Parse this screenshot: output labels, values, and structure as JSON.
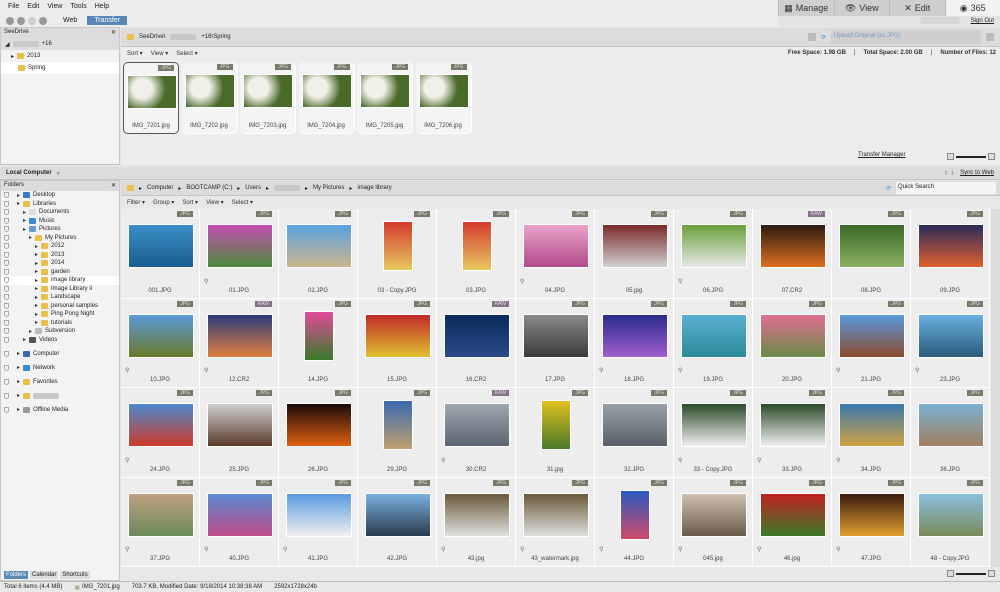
{
  "menu": [
    "File",
    "Edit",
    "View",
    "Tools",
    "Help"
  ],
  "toolbar": {
    "web": "Web",
    "transfer": "Transfer"
  },
  "mode_tabs": [
    {
      "label": "Manage",
      "icon": "grid-icon"
    },
    {
      "label": "View",
      "icon": "eye-icon"
    },
    {
      "label": "Edit",
      "icon": "tools-icon"
    },
    {
      "label": "365",
      "icon": "365-icon"
    }
  ],
  "sign_out": "Sign Out",
  "seedrive": {
    "title": "SeeDrive",
    "account_suffix": "+16",
    "items": [
      "2013",
      "Spring"
    ],
    "path_prefix": "SeeDrive\\",
    "path_suffix": "+16\\Spring",
    "menu": [
      "Sort ▾",
      "View ▾",
      "Select ▾"
    ],
    "upload": "Upload Original (as JPG)",
    "free_space": "Free Space: 1.98 GB",
    "total_space": "Total Space: 2.00 GB",
    "num_files": "Number of Files: 12",
    "transfer_manager": "Transfer Manager",
    "thumbs": [
      "IMG_7201.jpg",
      "IMG_7202.jpg",
      "IMG_7203.jpg",
      "IMG_7204.jpg",
      "IMG_7205.jpg",
      "IMG_7206.jpg"
    ]
  },
  "local": {
    "title": "Local Computer",
    "sync": "Sync to Web",
    "folders_title": "Folders",
    "tree": [
      [
        "Desktop",
        1
      ],
      [
        "Libraries",
        1
      ],
      [
        "Documents",
        2
      ],
      [
        "Music",
        2
      ],
      [
        "Pictures",
        2
      ],
      [
        "My Pictures",
        3
      ],
      [
        "2012",
        4
      ],
      [
        "2013",
        4
      ],
      [
        "2014",
        4
      ],
      [
        "garden",
        4
      ],
      [
        "image library",
        4
      ],
      [
        "Image Library ii",
        4
      ],
      [
        "Landscape",
        4
      ],
      [
        "personal samples",
        4
      ],
      [
        "Ping Pong Night",
        4
      ],
      [
        "tutorials",
        4
      ],
      [
        "Subversion",
        3
      ],
      [
        "Videos",
        2
      ],
      [
        "Computer",
        1
      ],
      [
        "Network",
        1
      ],
      [
        "Favorites",
        1
      ],
      [
        "",
        1
      ],
      [
        "Offline Media",
        1
      ]
    ],
    "breadcrumb": [
      "Computer",
      "BOOTCAMP (C:)",
      "Users",
      "",
      "My Pictures",
      "image library"
    ],
    "menu": [
      "Filter ▾",
      "Group ▾",
      "Sort ▾",
      "View ▾",
      "Select ▾"
    ],
    "quick_search": "Quick Search",
    "bottom_tabs": [
      "Folders",
      "Calendar",
      "Shortcuts"
    ],
    "files": [
      [
        "001.JPG",
        "JPG",
        "#3b8fc8",
        "#1a5c8f"
      ],
      [
        "01.JPG",
        "JPG",
        "#c54fb5",
        "#4d8a3a"
      ],
      [
        "02.JPG",
        "JPG",
        "#5aa0e0",
        "#c9b68a"
      ],
      [
        "03 - Copy.JPG",
        "JPG",
        "#d43a2e",
        "#e8c860"
      ],
      [
        "03.JPG",
        "JPG",
        "#d43a2e",
        "#e8c860"
      ],
      [
        "04.JPG",
        "JPG",
        "#e9a4c8",
        "#b24a8a"
      ],
      [
        "05.jpg",
        "JPG",
        "#7a2a2a",
        "#d0d0d0"
      ],
      [
        "06.JPG",
        "JPG",
        "#6aa03a",
        "#e8e8e8"
      ],
      [
        "07.CR2",
        "RAW",
        "#2a1a10",
        "#e07020"
      ],
      [
        "08.JPG",
        "JPG",
        "#3a6a2a",
        "#8ab060"
      ],
      [
        "09.JPG",
        "JPG",
        "#2a2a5a",
        "#e06030"
      ],
      [
        "10.JPG",
        "JPG",
        "#5a9ad8",
        "#6a7a2a"
      ],
      [
        "12.CR2",
        "RAW",
        "#2a3a7a",
        "#e08040"
      ],
      [
        "14.JPG",
        "JPG",
        "#e04a9a",
        "#3a7a2a"
      ],
      [
        "15.JPG",
        "JPG",
        "#c02a2a",
        "#e0c030"
      ],
      [
        "16.CR2",
        "RAW",
        "#0a2a5a",
        "#2a4a8a"
      ],
      [
        "17.JPG",
        "JPG",
        "#8a8a8a",
        "#3a3a3a"
      ],
      [
        "18.JPG",
        "JPG",
        "#2a2a8a",
        "#a060d0"
      ],
      [
        "19.JPG",
        "JPG",
        "#5ab0d0",
        "#2a8a9a"
      ],
      [
        "20.JPG",
        "JPG",
        "#e07090",
        "#6a8a4a"
      ],
      [
        "21.JPG",
        "JPG",
        "#5a9ae0",
        "#8a4a2a"
      ],
      [
        "23.JPG",
        "JPG",
        "#6ab0e0",
        "#2a5a7a"
      ],
      [
        "24.JPG",
        "JPG",
        "#4a8ad0",
        "#d03a2a"
      ],
      [
        "25.JPG",
        "JPG",
        "#d0d0d0",
        "#5a3a2a"
      ],
      [
        "26.JPG",
        "JPG",
        "#1a0a0a",
        "#e06010"
      ],
      [
        "29.JPG",
        "JPG",
        "#3a6ab0",
        "#c0a070"
      ],
      [
        "30.CR2",
        "RAW",
        "#a0a8b0",
        "#5a6470"
      ],
      [
        "31.jpg",
        "JPG",
        "#e0c020",
        "#4a7a2a"
      ],
      [
        "32.JPG",
        "JPG",
        "#9aa0a8",
        "#5a6068"
      ],
      [
        "33 - Copy.JPG",
        "JPG",
        "#2a4a2a",
        "#f0f0f0"
      ],
      [
        "33.JPG",
        "JPG",
        "#2a4a2a",
        "#f0f0f0"
      ],
      [
        "34.JPG",
        "JPG",
        "#3a7ab0",
        "#d0a040"
      ],
      [
        "36.JPG",
        "JPG",
        "#7ab0d0",
        "#a08060"
      ],
      [
        "37.JPG",
        "JPG",
        "#c0a080",
        "#6a8a5a"
      ],
      [
        "40.JPG",
        "JPG",
        "#5a8ad0",
        "#c04a8a"
      ],
      [
        "41.JPG",
        "JPG",
        "#5a9ae0",
        "#f0f0f0"
      ],
      [
        "42.JPG",
        "JPG",
        "#7ab0e0",
        "#2a3a4a"
      ],
      [
        "43.jpg",
        "JPG",
        "#6a5a3a",
        "#e0e0e0"
      ],
      [
        "43_watermark.jpg",
        "JPG",
        "#6a5a3a",
        "#e0e0e0"
      ],
      [
        "44.JPG",
        "JPG",
        "#2a5ac0",
        "#d04a6a"
      ],
      [
        "045.jpg",
        "JPG",
        "#d0c0b0",
        "#6a5a4a"
      ],
      [
        "46.jpg",
        "JPG",
        "#c02020",
        "#3a7a2a"
      ],
      [
        "47.JPG",
        "JPG",
        "#3a1a10",
        "#e0a030"
      ],
      [
        "48 - Copy.JPG",
        "JPG",
        "#8ac0e0",
        "#7a8a5a"
      ]
    ]
  },
  "status": {
    "total": "Total 6 items  (4.4 MB)",
    "file": "IMG_7201.jpg",
    "details": "703.7 KB, Modified Date: 9/18/2014 10:38:38 AM",
    "dims": "2592x1728x24b"
  }
}
